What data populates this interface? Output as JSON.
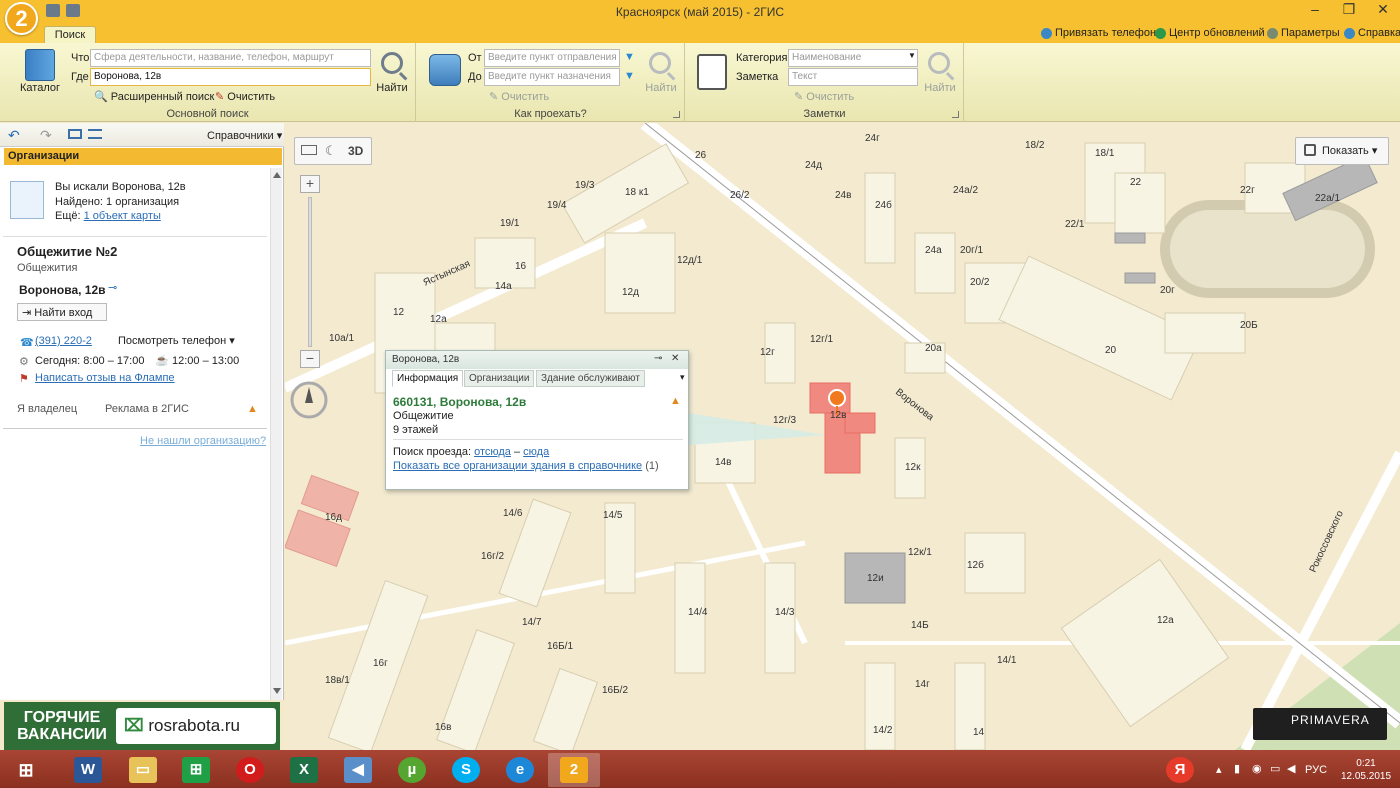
{
  "window": {
    "title": "Красноярск (май 2015) - 2ГИС",
    "logo": "2"
  },
  "tabs": {
    "search": "Поиск"
  },
  "top_links": {
    "bind_phone": "Привязать телефон",
    "update_center": "Центр обновлений",
    "params": "Параметры",
    "help": "Справка"
  },
  "ribbon": {
    "catalog_label": "Каталог",
    "what_label": "Что",
    "what_placeholder": "Сфера деятельности, название, телефон, маршрут",
    "where_label": "Где",
    "where_value": "Воронова, 12в",
    "find_label": "Найти",
    "advanced": "Расширенный поиск",
    "clear": "Очистить",
    "group_main": "Основной поиск",
    "from_label": "От",
    "from_placeholder": "Введите пункт отправления",
    "to_label": "До",
    "to_placeholder": "Введите пункт назначения",
    "route_clear": "Очистить",
    "route_find": "Найти",
    "group_route": "Как проехать?",
    "category_label": "Категория",
    "category_placeholder": "Наименование",
    "note_label": "Заметка",
    "note_placeholder": "Текст",
    "notes_clear": "Очистить",
    "notes_find": "Найти",
    "group_notes": "Заметки"
  },
  "left_panel": {
    "directory": "Справочники",
    "header": "Организации",
    "searched": "Вы искали Воронова, 12в",
    "found": "Найдено: 1 организация",
    "more_prefix": "Ещё:",
    "more_link": "1 объект карты",
    "org_name": "Общежитие №2",
    "org_type": "Общежития",
    "org_address": "Воронова, 12в",
    "entrance": "Найти вход",
    "phone": "(391) 220-2",
    "phone_link": "Посмотреть телефон",
    "hours": "Сегодня: 8:00 – 17:00",
    "lunch": "12:00 – 13:00",
    "review": "Написать отзыв на Флампе",
    "owner": "Я владелец",
    "ads": "Реклама в 2ГИС",
    "not_found": "Не нашли организацию?"
  },
  "banner": {
    "hot": "ГОРЯЧИЕ ВАКАНСИИ",
    "site": "rosrabota.ru"
  },
  "map": {
    "btn_3d": "3D",
    "show": "Показать",
    "labels": [
      "26",
      "24г",
      "18/2",
      "18/1",
      "22",
      "24д",
      "24в",
      "24а/2",
      "22г",
      "22а/1",
      "19/3",
      "18 к1",
      "26/2",
      "24б",
      "22/1",
      "19/4",
      "19/1",
      "24а",
      "20г/1",
      "16",
      "12д/1",
      "14а",
      "20/2",
      "20г",
      "12",
      "12д",
      "20Б",
      "10а/1",
      "12а",
      "12г",
      "12г/1",
      "20а",
      "20",
      "12г/3",
      "12в",
      "14в",
      "12к",
      "14/6",
      "14/5",
      "16д",
      "16г/2",
      "12к/1",
      "12б",
      "12и",
      "14/4",
      "14/3",
      "14/7",
      "14Б",
      "16Б/1",
      "12а",
      "16г",
      "14/1",
      "18в/1",
      "16Б/2",
      "14г",
      "16в",
      "14/2",
      "14"
    ],
    "streets": {
      "voronova": "Воронова",
      "yastynskaya": "Ястынская",
      "rokossovskogo": "Рокоссовского"
    },
    "primavera": "PRIMAVERA"
  },
  "popup": {
    "title": "Воронова, 12в",
    "tab_info": "Информация",
    "tab_orgs": "Организации",
    "tab_service": "Здание обслуживают",
    "address": "660131, Воронова, 12в",
    "type": "Общежитие",
    "floors": "9 этажей",
    "route_prefix": "Поиск проезда:",
    "route_from": "отсюда",
    "route_dash": "–",
    "route_to": "сюда",
    "show_all": "Показать все организации здания в справочнике",
    "show_all_count": "(1)"
  },
  "taskbar": {
    "lang": "РУС",
    "time": "0:21",
    "date": "12.05.2015"
  },
  "colors": {
    "accent": "#f6c030",
    "building": "#f8f4e4",
    "target": "#f08a80",
    "link": "#2a6db5"
  }
}
